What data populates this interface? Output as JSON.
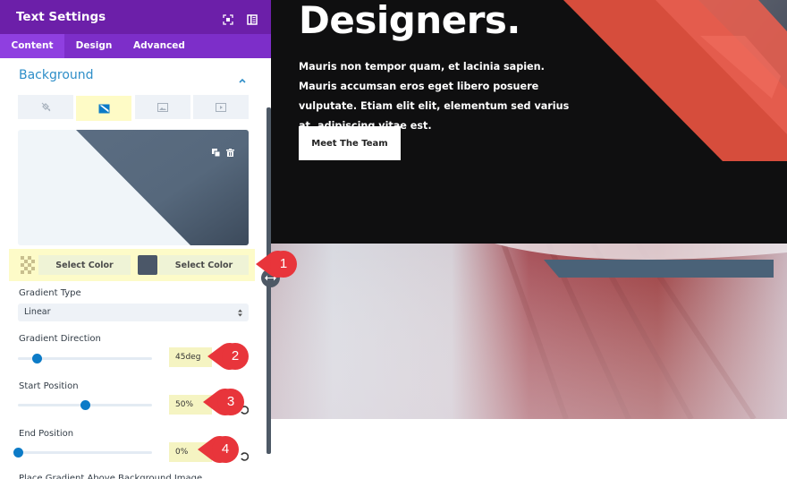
{
  "panel": {
    "title": "Text Settings",
    "header_icons": [
      "expand-icon",
      "split-view-icon"
    ],
    "tabs": [
      {
        "label": "Content",
        "active": true
      },
      {
        "label": "Design",
        "active": false
      },
      {
        "label": "Advanced",
        "active": false
      }
    ],
    "section": {
      "title": "Background",
      "expanded": true
    },
    "background_types": [
      {
        "name": "color",
        "icon": "paint-bucket-icon",
        "active": false
      },
      {
        "name": "gradient",
        "icon": "gradient-icon",
        "active": true
      },
      {
        "name": "image",
        "icon": "image-icon",
        "active": false
      },
      {
        "name": "video",
        "icon": "video-icon",
        "active": false
      }
    ],
    "preview_tools": [
      "duplicate-icon",
      "trash-icon"
    ],
    "gradient_colors": [
      {
        "swatch": "transparent",
        "label": "Select Color"
      },
      {
        "swatch": "#4b5768",
        "label": "Select Color"
      }
    ],
    "gradient_type": {
      "label": "Gradient Type",
      "value": "Linear"
    },
    "gradient_direction": {
      "label": "Gradient Direction",
      "value": "45deg",
      "slider_fraction": 0.14
    },
    "start_position": {
      "label": "Start Position",
      "value": "50%",
      "slider_fraction": 0.5
    },
    "end_position": {
      "label": "End Position",
      "value": "0%",
      "slider_fraction": 0.0
    },
    "cut_label": "Place Gradient Above Background Image"
  },
  "callouts": [
    "1",
    "2",
    "3",
    "4"
  ],
  "colors": {
    "header": "#6c1fa9",
    "tabs": "#7d2ec9",
    "accent_blue": "#2e8ec8",
    "highlight": "#fdfbc8",
    "callout_red": "#e8353b",
    "gradient_dark": "#4b5768",
    "hero_bg": "#0f0f10",
    "hero_accent": "#d64d3c"
  },
  "hero": {
    "title": "Designers.",
    "text": "Mauris non tempor quam, et lacinia sapien. Mauris accumsan eros eget libero posuere vulputate. Etiam elit elit, elementum sed varius at, adipiscing vitae est.",
    "button": "Meet The Team"
  }
}
